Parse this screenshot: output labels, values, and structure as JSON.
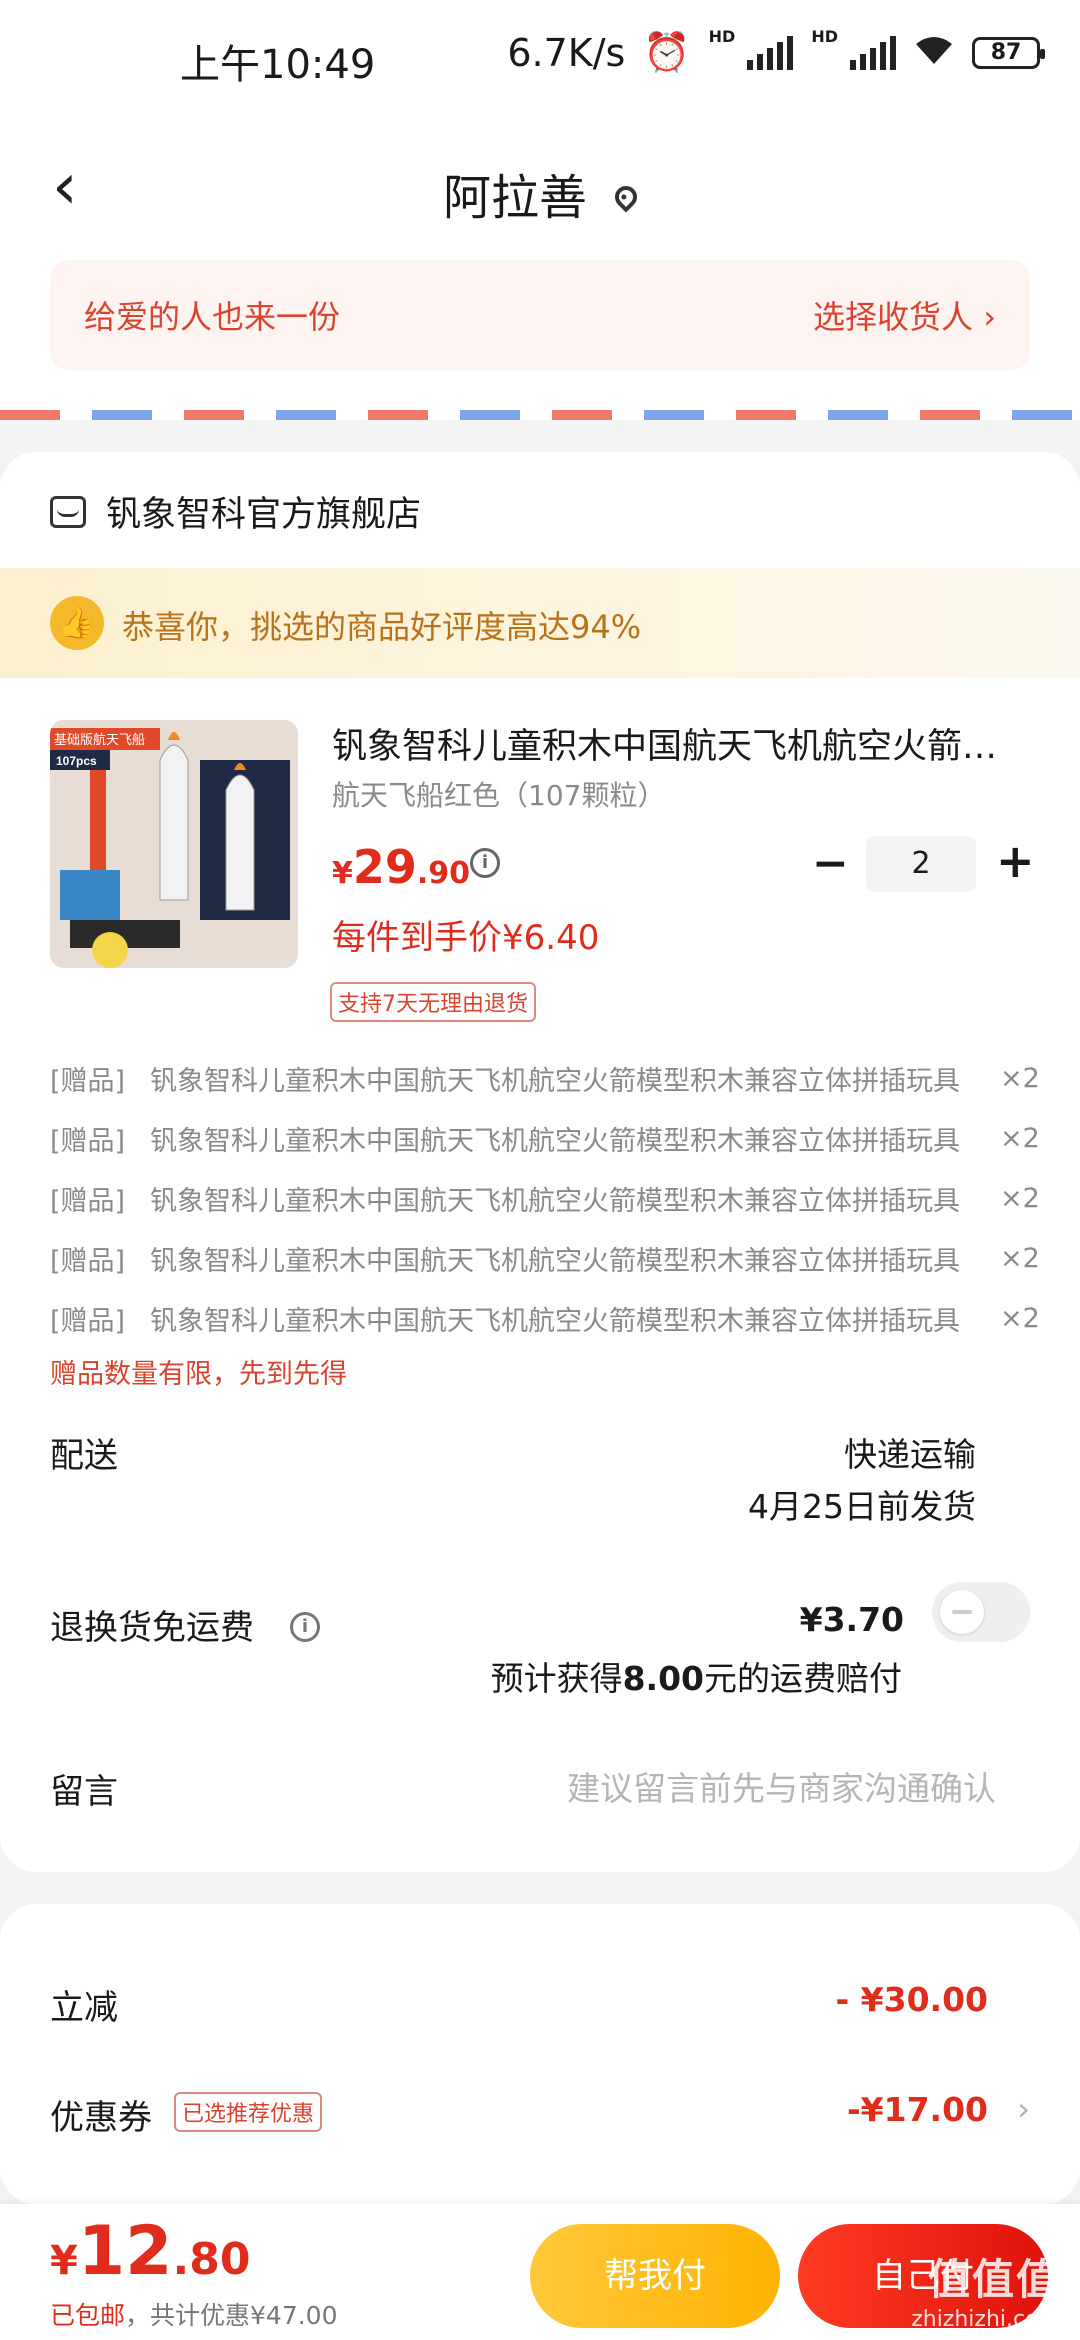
{
  "status_bar": {
    "time": "上午10:49",
    "speed": "6.7K/s",
    "battery": "87",
    "hd": "HD"
  },
  "header": {
    "title": "阿拉善"
  },
  "gift_banner": {
    "left": "给爱的人也来一份",
    "right": "选择收货人 ›"
  },
  "shop": {
    "name": "钒象智科官方旗舰店"
  },
  "praise": {
    "text": "恭喜你，挑选的商品好评度高达94%"
  },
  "product": {
    "image_badge": "基础版航天飞船",
    "image_count": "107pcs",
    "name": "钒象智科儿童积木中国航天飞机航空火箭模型积木兼容立体拼插玩具",
    "spec": "航天飞船红色（107颗粒）",
    "currency": "¥",
    "price_int": "29",
    "price_dec": ".90",
    "quantity": "2",
    "unit_price": "每件到手价¥6.40",
    "return_tag": "支持7天无理由退货"
  },
  "gifts": [
    {
      "tag": "[赠品]",
      "name": "钒象智科儿童积木中国航天飞机航空火箭模型积木兼容立体拼插玩具",
      "count": "×2"
    },
    {
      "tag": "[赠品]",
      "name": "钒象智科儿童积木中国航天飞机航空火箭模型积木兼容立体拼插玩具",
      "count": "×2"
    },
    {
      "tag": "[赠品]",
      "name": "钒象智科儿童积木中国航天飞机航空火箭模型积木兼容立体拼插玩具",
      "count": "×2"
    },
    {
      "tag": "[赠品]",
      "name": "钒象智科儿童积木中国航天飞机航空火箭模型积木兼容立体拼插玩具",
      "count": "×2"
    },
    {
      "tag": "[赠品]",
      "name": "钒象智科儿童积木中国航天飞机航空火箭模型积木兼容立体拼插玩具",
      "count": "×2"
    }
  ],
  "gift_note": "赠品数量有限，先到先得",
  "shipping": {
    "label": "配送",
    "method": "快递运输",
    "date": "4月25日前发货"
  },
  "return_insurance": {
    "label": "退换货免运费",
    "price": "¥3.70",
    "compensation_pre": "预计获得",
    "compensation_amount": "8.00",
    "compensation_post": "元的运费赔付"
  },
  "message": {
    "label": "留言",
    "placeholder": "建议留言前先与商家沟通确认"
  },
  "discounts": {
    "instant_label": "立减",
    "instant_amount": "- ¥30.00",
    "coupon_label": "优惠券",
    "coupon_tag": "已选推荐优惠",
    "coupon_amount": "-¥17.00"
  },
  "bottom": {
    "currency": "¥",
    "total_int": "12",
    "total_dec": ".80",
    "shipping_free": "已包邮",
    "saved": "，共计优惠¥47.00",
    "help_pay": "帮我付",
    "self_pay": "自己付"
  },
  "watermark": {
    "text": "值值值",
    "site": "zhizhizhi.com"
  },
  "colors": {
    "accent_red": "#e02c1c",
    "gold": "#ffb300"
  }
}
